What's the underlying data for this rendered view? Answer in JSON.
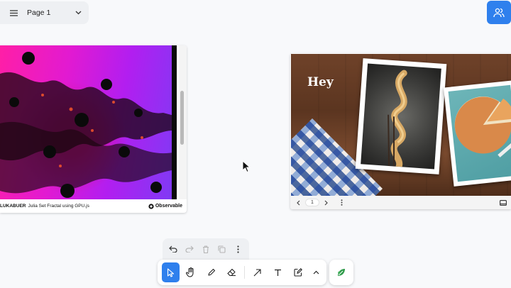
{
  "page_menu": {
    "title": "Page 1",
    "menu_icon": "hamburger-icon",
    "dropdown_icon": "chevron-down-icon"
  },
  "share": {
    "icon": "people-icon",
    "color": "#2f80ed"
  },
  "fractal_card": {
    "author": "LUKABUER",
    "caption": "Julia Set Fractal using GPU.js",
    "brand": "Observable",
    "colors": {
      "magenta": "#e21ad1",
      "violet": "#7c3cf5",
      "pink": "#ff1fa6"
    }
  },
  "slide_card": {
    "slide_text": "Hey",
    "page_number": "1",
    "icons": [
      "chevron-left-icon",
      "chevron-right-icon",
      "more-vertical-icon",
      "present-icon"
    ]
  },
  "edit_bar": {
    "icons": [
      "undo-icon",
      "redo-icon",
      "trash-icon",
      "duplicate-icon",
      "more-vertical-icon"
    ]
  },
  "toolbar": {
    "accent": "#2f80ed",
    "tools": [
      "select-tool",
      "hand-tool",
      "pencil-tool",
      "eraser-tool",
      "arrow-tool",
      "text-tool",
      "note-tool",
      "expand-tool"
    ],
    "active_tool": "select-tool"
  },
  "gallery": {
    "icon": "leaf-icon",
    "color": "#2f9b4a"
  }
}
